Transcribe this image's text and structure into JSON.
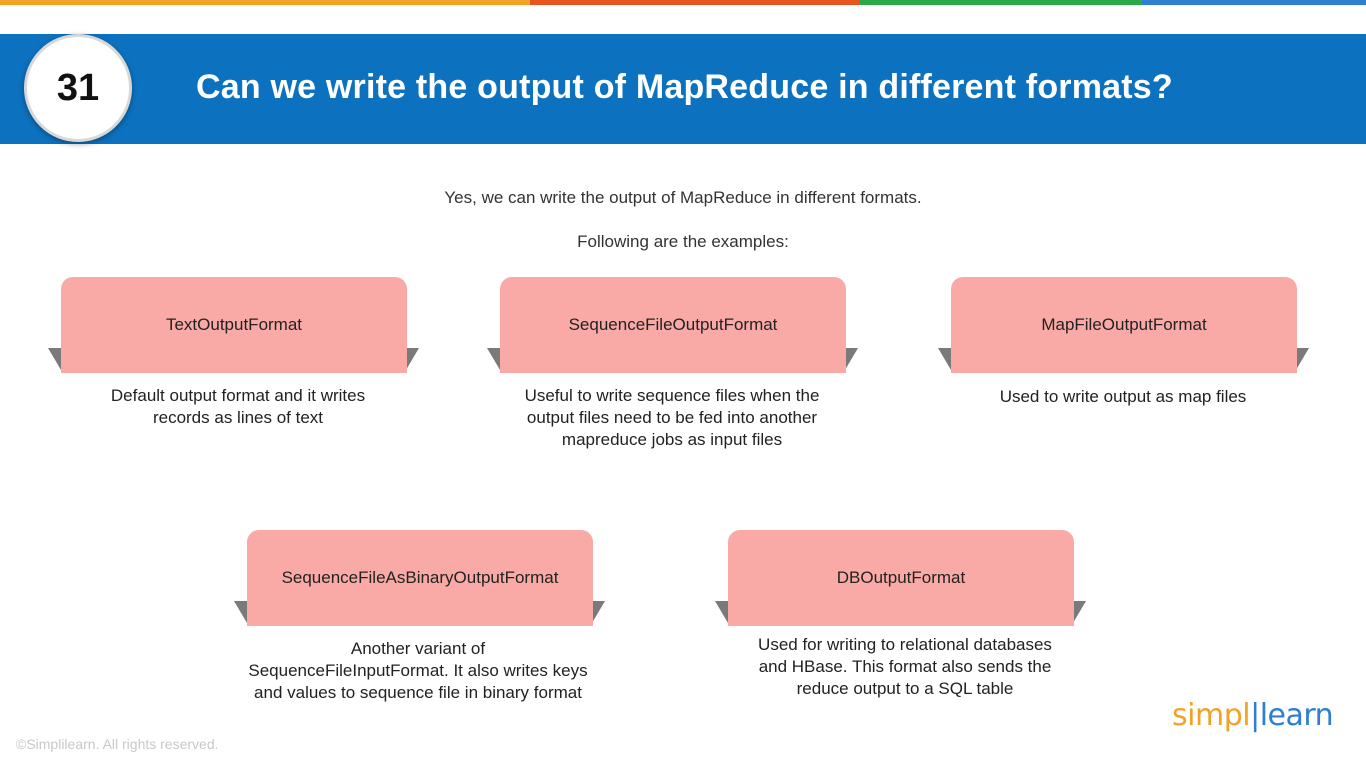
{
  "header": {
    "number": "31",
    "title": "Can we write the output of MapReduce in different formats?"
  },
  "intro": {
    "line1": "Yes, we can write the output of MapReduce in different formats.",
    "line2": "Following are the examples:"
  },
  "formats": [
    {
      "name": "TextOutputFormat",
      "description": [
        "Default output format and it writes",
        "records as lines of text"
      ]
    },
    {
      "name": "SequenceFileOutputFormat",
      "description": [
        "Useful to write sequence files when the",
        "output files need to be fed into another",
        "mapreduce jobs as input files"
      ]
    },
    {
      "name": "MapFileOutputFormat",
      "description": [
        "Used to write output as map files"
      ]
    },
    {
      "name": "SequenceFileAsBinaryOutputFormat",
      "description": [
        "Another variant of",
        "SequenceFileInputFormat. It also writes keys",
        "and values to sequence file in binary format"
      ]
    },
    {
      "name": "DBOutputFormat",
      "description": [
        "Used for writing to relational databases",
        "and HBase. This format also sends the",
        "reduce output to a SQL table"
      ]
    }
  ],
  "footer": {
    "copyright": "©Simplilearn. All rights reserved.",
    "logo_part1": "simpl",
    "logo_part2": "learn"
  },
  "colors": {
    "header_blue": "#0c72c0",
    "card_pink": "#f9aaa6",
    "fold_gray": "#7a7a7a",
    "topbar": [
      "#f2a325",
      "#e8541e",
      "#2aa84a",
      "#2f7fd0"
    ]
  }
}
